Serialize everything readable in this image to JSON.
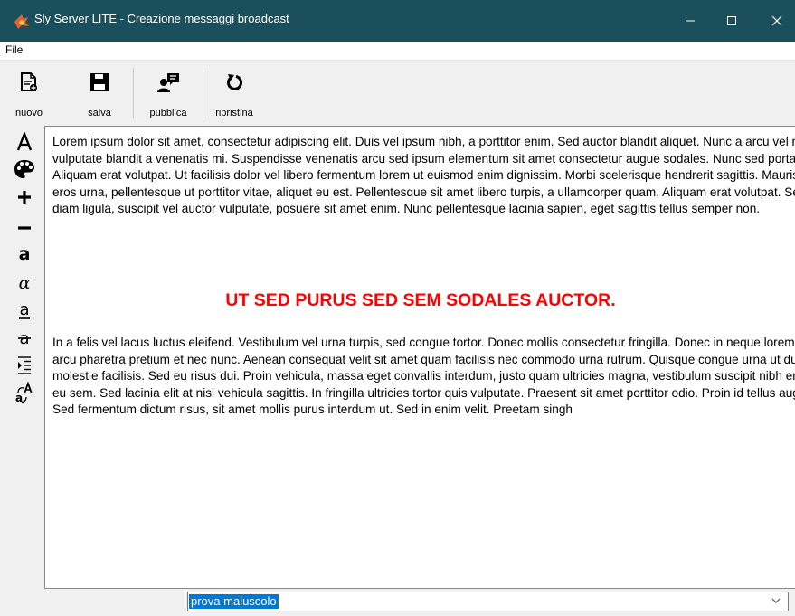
{
  "window": {
    "title": "Sly Server LITE - Creazione messaggi broadcast",
    "accent": "#1b4f5b"
  },
  "menu": {
    "file": "File"
  },
  "toolbar": {
    "items": [
      {
        "label": "nuovo",
        "icon": "new-document-icon"
      },
      {
        "label": "salva",
        "icon": "save-icon"
      },
      {
        "label": "pubblica",
        "icon": "publish-icon"
      },
      {
        "label": "ripristina",
        "icon": "restore-icon"
      }
    ]
  },
  "sidebar": {
    "tools": [
      "font-icon",
      "palette-icon",
      "increase-size-icon",
      "decrease-size-icon",
      "bold-icon",
      "italic-icon",
      "underline-icon",
      "strikethrough-icon",
      "indent-icon",
      "case-toggle-icon"
    ]
  },
  "editor": {
    "paragraph1": "Lorem ipsum dolor sit amet, consectetur adipiscing elit. Duis vel ipsum nibh, a porttitor enim. Sed auctor blandit aliquet. Nunc a arcu vel nisl vulputate blandit a venenatis mi. Suspendisse venenatis arcu sed ipsum elementum sit amet consectetur augue sodales. Nunc sed porta mi. Aliquam erat volutpat. Ut facilisis dolor vel libero fermentum lorem ut euismod enim dignissim. Morbi scelerisque hendrerit sagittis. Mauris eros urna, pellentesque ut porttitor vitae, aliquet eu est. Pellentesque sit amet libero turpis, a ullamcorper quam. Aliquam erat volutpat. Sed diam ligula, suscipit vel auctor vulputate, posuere sit amet enim. Nunc pellentesque lacinia sapien, eget sagittis tellus semper non.",
    "heading": "UT SED PURUS SED SEM SODALES AUCTOR.",
    "heading_color": "#ff0000",
    "paragraph2": "In a felis vel lacus luctus eleifend. Vestibulum vel urna turpis, sed congue tortor. Donec mollis consectetur fringilla. Donec in neque lorem id arcu pharetra pretium et nec nunc. Aenean consequat velit sit amet quam facilisis nec commodo urna rutrum. Quisque congue urna ut dui molestie facilisis. Sed eu risus dui. Proin vehicula, massa eget convallis interdum, justo quam ultricies magna, vestibulum suscipit nibh eros eu sem. Sed lacinia elit at nisl vehicula sagittis. In fringilla ultricies tortor quis vulputate. Praesent sit amet porttitor odio. Proin id tellus augue. Sed fermentum dictum risus, sit amet mollis purus interdum ut. Sed in enim velit. Preetam singh"
  },
  "style_selector": {
    "value": "prova maiuscolo"
  }
}
